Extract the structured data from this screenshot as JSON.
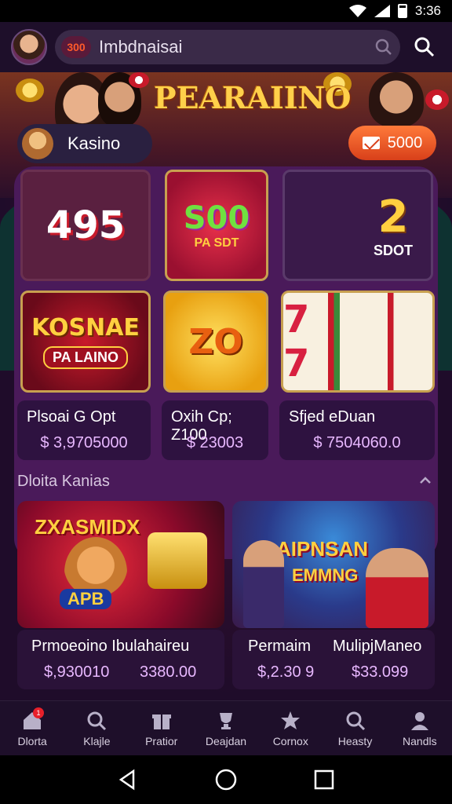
{
  "status_bar": {
    "time": "3:36"
  },
  "top_bar": {
    "search_logo_text": "300",
    "search_text": "Imbdnaisai"
  },
  "hero": {
    "title": "PEARAIINO",
    "kasino_label": "Kasino",
    "coin_value": "5000"
  },
  "games": [
    {
      "label_big": "495",
      "label_small": ""
    },
    {
      "label_big": "S00",
      "label_small": "PA SDT"
    },
    {
      "label_big": "2",
      "label_small": "SDOT"
    },
    {
      "label_big": "KOSNAE",
      "label_small": "PA LAINO"
    },
    {
      "label_big": "ZO",
      "label_small": ""
    },
    {
      "label_big": "7 7",
      "label_small": ""
    }
  ],
  "cards": [
    {
      "name": "Plsoai G Opt",
      "price": "$ 3,9705000"
    },
    {
      "name": "Oxih Cp; Z100",
      "price": "$ 23003"
    },
    {
      "name": "Sfjed eDuan",
      "price": "$ 7504060.0"
    }
  ],
  "section": {
    "title": "Dloita Kanias"
  },
  "promos": [
    {
      "banner": "ZXASMIDX",
      "banner_sub": "APB",
      "name": "Prmoeoino Ibulahaireu",
      "price_1": "$,930010",
      "price_2": "3380.00"
    },
    {
      "banner": "AIPNSAN",
      "banner_sub": "EMMNG",
      "name_1": "Permaim",
      "name_2": "MulipjManeo",
      "price_1": "$,2.30 9",
      "price_2": "$33.099"
    }
  ],
  "bottom_nav": [
    {
      "icon": "home-icon",
      "label": "Dlorta",
      "badge": "1"
    },
    {
      "icon": "search-icon",
      "label": "Klajle"
    },
    {
      "icon": "gift-icon",
      "label": "Pratior"
    },
    {
      "icon": "trophy-icon",
      "label": "Deajdan"
    },
    {
      "icon": "star-icon",
      "label": "Cornox"
    },
    {
      "icon": "search-icon",
      "label": "Heasty"
    },
    {
      "icon": "person-icon",
      "label": "Nandls"
    }
  ],
  "colors": {
    "accent": "#ff6a2a",
    "panel": "#4a1a5a",
    "price": "#e8b8ff"
  }
}
